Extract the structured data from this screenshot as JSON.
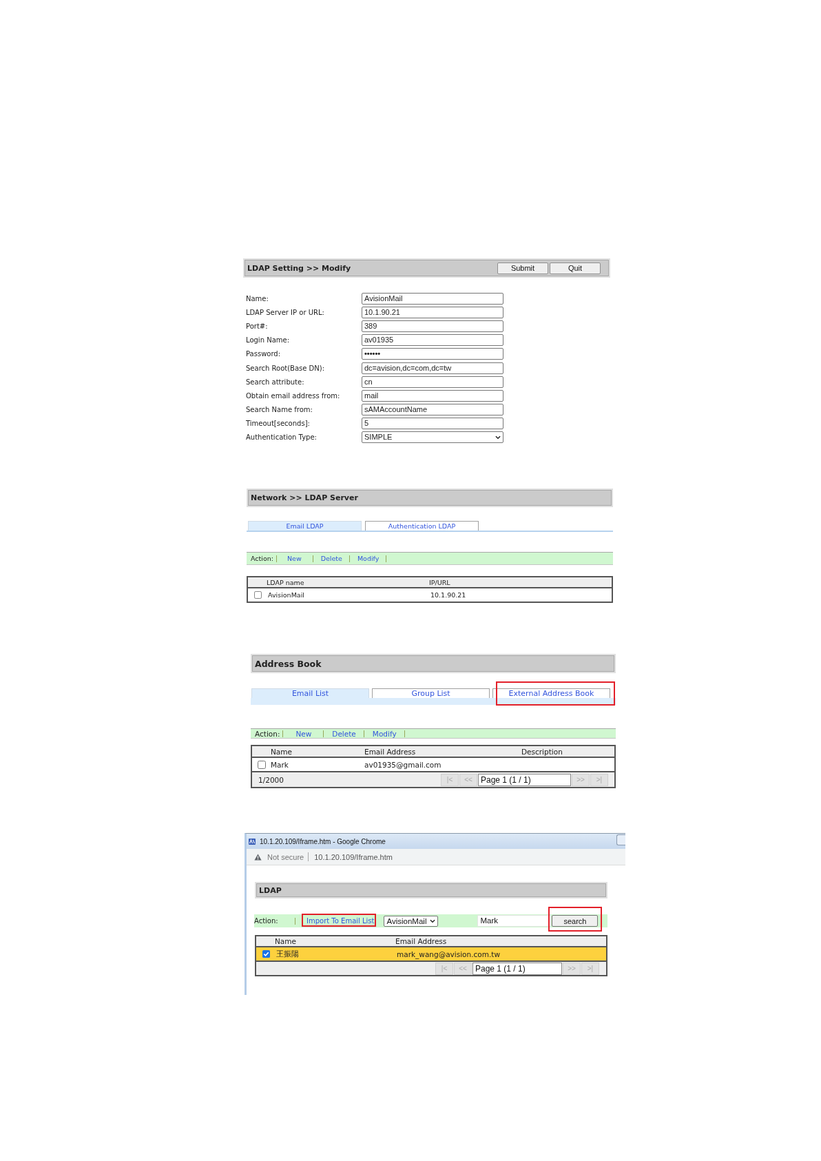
{
  "ldap_setting": {
    "title": "LDAP Setting >> Modify",
    "buttons": [
      "Submit",
      "Quit"
    ],
    "fields": [
      {
        "kind": "text",
        "label": "Name:",
        "value": "AvisionMail"
      },
      {
        "kind": "text",
        "label": "LDAP Server IP or URL:",
        "value": "10.1.90.21"
      },
      {
        "kind": "text",
        "label": "Port#:",
        "value": "389"
      },
      {
        "kind": "text",
        "label": "Login Name:",
        "value": "av01935"
      },
      {
        "kind": "password",
        "label": "Password:",
        "value": "••••••"
      },
      {
        "kind": "text",
        "label": "Search Root(Base DN):",
        "value": "dc=avision,dc=com,dc=tw"
      },
      {
        "kind": "text",
        "label": "Search attribute:",
        "value": "cn"
      },
      {
        "kind": "text",
        "label": "Obtain email address from:",
        "value": "mail"
      },
      {
        "kind": "text",
        "label": "Search Name from:",
        "value": "sAMAccountName"
      },
      {
        "kind": "text",
        "label": "Timeout[seconds]:",
        "value": "5"
      },
      {
        "kind": "select",
        "label": "Authentication Type:",
        "value": "SIMPLE"
      }
    ]
  },
  "ldap_server": {
    "title": "Network >> LDAP Server",
    "tabs": [
      {
        "label": "Email LDAP",
        "selected": true
      },
      {
        "label": "Authentication LDAP",
        "selected": false
      }
    ],
    "action_bar": {
      "label": "Action:",
      "links": [
        "New",
        "Delete",
        "Modify"
      ]
    },
    "table": {
      "columns": [
        "LDAP name",
        "IP/URL"
      ],
      "rows": [
        {
          "checked": false,
          "selected": false,
          "cells": [
            "AvisionMail",
            "10.1.90.21"
          ]
        }
      ]
    }
  },
  "address_book": {
    "title": "Address Book",
    "tabs": [
      {
        "label": "Email List",
        "selected": true,
        "highlighted": false
      },
      {
        "label": "Group List",
        "selected": false,
        "highlighted": false
      },
      {
        "label": "External Address Book",
        "selected": false,
        "highlighted": true
      }
    ],
    "action_bar": {
      "label": "Action:",
      "links": [
        "New",
        "Delete",
        "Modify"
      ]
    },
    "table": {
      "columns": [
        "Name",
        "Email Address",
        "Description"
      ],
      "rows": [
        {
          "checked": false,
          "selected": false,
          "cells": [
            "Mark",
            "av01935@gmail.com"
          ]
        }
      ],
      "footer": {
        "count": "1/2000",
        "pager": {
          "buttons": [
            {
              "label": "|<",
              "disabled": true
            },
            {
              "label": "<<",
              "disabled": true
            },
            {
              "label": ">>",
              "disabled": true
            },
            {
              "label": ">|",
              "disabled": true
            }
          ],
          "page": "Page 1 (1 / 1)"
        }
      }
    }
  },
  "browser_window": {
    "title": "10.1.20.109/Iframe.htm - Google Chrome",
    "address_bar": {
      "security": "Not secure",
      "url": "10.1.20.109/Iframe.htm"
    },
    "panel": {
      "title": "LDAP",
      "action_bar": {
        "label": "Action:",
        "import_link": {
          "label": "Import To Email List",
          "highlighted": true
        },
        "source_select": {
          "value": "AvisionMail"
        },
        "search_field": {
          "value": "Mark"
        },
        "search_button": {
          "label": "search",
          "highlighted": true
        }
      },
      "table": {
        "columns": [
          "Name",
          "Email Address"
        ],
        "rows": [
          {
            "checked": true,
            "selected": true,
            "cells": [
              "王振陽",
              "mark_wang@avision.com.tw"
            ]
          }
        ],
        "footer": {
          "pager": {
            "buttons": [
              {
                "label": "|<",
                "disabled": true
              },
              {
                "label": "<<",
                "disabled": true
              },
              {
                "label": ">>",
                "disabled": true
              },
              {
                "label": ">|",
                "disabled": true
              }
            ],
            "page": "Page 1 (1 / 1)"
          }
        }
      }
    }
  }
}
